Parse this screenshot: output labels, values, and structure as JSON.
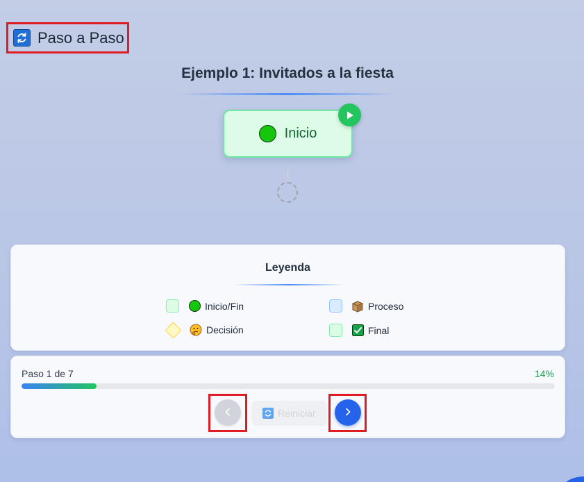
{
  "header": {
    "title": "Paso a Paso",
    "icon": "refresh-icon"
  },
  "flow": {
    "heading": "Ejemplo 1: Invitados a la fiesta",
    "start_node": {
      "label": "Inicio",
      "icon": "green-circle-icon",
      "badge_icon": "play-icon"
    },
    "next_placeholder": "pending-node"
  },
  "legend": {
    "title": "Leyenda",
    "items": [
      {
        "label": "Inicio/Fin",
        "icon": "green-circle-icon",
        "swatch": "green"
      },
      {
        "label": "Proceso",
        "icon": "package-icon",
        "swatch": "blue"
      },
      {
        "label": "Decisión",
        "icon": "thinking-face-icon",
        "swatch": "diamond"
      },
      {
        "label": "Final",
        "icon": "check-mark-icon",
        "swatch": "green"
      }
    ]
  },
  "progress": {
    "step_label": "Paso 1 de 7",
    "percent_label": "14%",
    "fraction": 0.14
  },
  "controls": {
    "reset_label": "Reiniciar",
    "prev_icon": "chevron-left-icon",
    "next_icon": "chevron-right-icon"
  },
  "colors": {
    "accent": "#2563eb",
    "success": "#22c55e",
    "highlight_frame": "#e01b24"
  }
}
